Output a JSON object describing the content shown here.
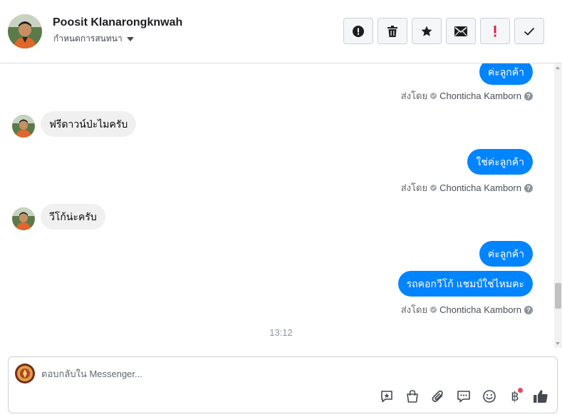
{
  "header": {
    "contact_name": "Poosit Klanarongknwah",
    "label_link": "กำหนดการสนทนา",
    "actions": [
      {
        "icon": "alert-circle-icon",
        "color": "#1c1e21"
      },
      {
        "icon": "trash-icon",
        "color": "#1c1e21"
      },
      {
        "icon": "star-icon",
        "color": "#1c1e21"
      },
      {
        "icon": "mail-icon",
        "color": "#1c1e21"
      },
      {
        "icon": "exclamation-icon",
        "color": "#e41e3f"
      },
      {
        "icon": "checkmark-icon",
        "color": "#1c1e21"
      }
    ]
  },
  "thread": {
    "messages": [
      {
        "direction": "out",
        "text": "ค่ะลูกค้า"
      },
      {
        "direction": "meta",
        "prefix": "ส่งโดย",
        "name": "Chonticha Kamborn"
      },
      {
        "direction": "in",
        "text": "ฟรีดาวน์ป่ะไมครับ"
      },
      {
        "direction": "out",
        "text": "ใช่ค่ะลูกค้า"
      },
      {
        "direction": "meta",
        "prefix": "ส่งโดย",
        "name": "Chonticha Kamborn"
      },
      {
        "direction": "in",
        "text": "วีโก้น่ะครับ"
      },
      {
        "direction": "out",
        "text": "ค่ะลูกค้า"
      },
      {
        "direction": "out",
        "text": "รถคอกวีโก้ แชมป์ใช่ไหมคะ"
      },
      {
        "direction": "meta",
        "prefix": "ส่งโดย",
        "name": "Chonticha Kamborn"
      }
    ],
    "timestamp": "13:12",
    "help_glyph": "?"
  },
  "composer": {
    "placeholder": "ตอบกลับใน Messenger...",
    "tools": [
      "saved-reply-icon",
      "shop-bag-icon",
      "paperclip-icon",
      "chat-bubble-icon",
      "emoji-icon",
      "baht-payment-icon",
      "thumbs-up-icon"
    ],
    "baht_symbol": "฿"
  },
  "colors": {
    "accent": "#0084ff",
    "incoming_bubble": "#f0f0f0",
    "alert": "#e41e3f",
    "notification_dot": "#f3425f"
  }
}
